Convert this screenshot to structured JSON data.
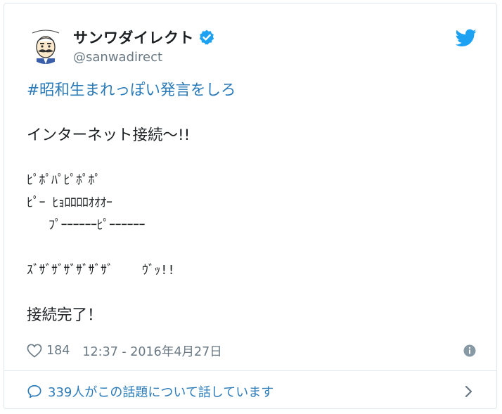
{
  "user": {
    "display_name": "サンワダイレクト",
    "handle": "@sanwadirect",
    "verified": true,
    "avatar_icon": "mascot-avatar-icon"
  },
  "tweet": {
    "hashtag": "#昭和生まれっぽい発言をしろ",
    "lines": [
      "",
      "インターネット接続〜!!",
      "",
      "ﾋﾟﾎﾟﾊﾟﾋﾟﾎﾟﾎﾟ",
      "ﾋﾟｰ ﾋｮﾛﾛﾛﾛｵｵｵｰ",
      "   ﾌﾟｰｰｰｰｰｰﾋﾟｰｰｰｰｰｰ",
      "",
      "ｽﾞｻﾞｻﾞｻﾞｻﾞｻﾞｻﾞ    ｳﾞｯ!!",
      "",
      "接続完了！"
    ],
    "likes": "184",
    "timestamp": "12:37 - 2016年4月27日"
  },
  "footer": {
    "conversation_text": "339人がこの話題について話しています"
  },
  "colors": {
    "link": "#2b7bb9",
    "twitter_blue": "#1da1f2",
    "muted": "#697882",
    "border": "#e1e8ed"
  }
}
